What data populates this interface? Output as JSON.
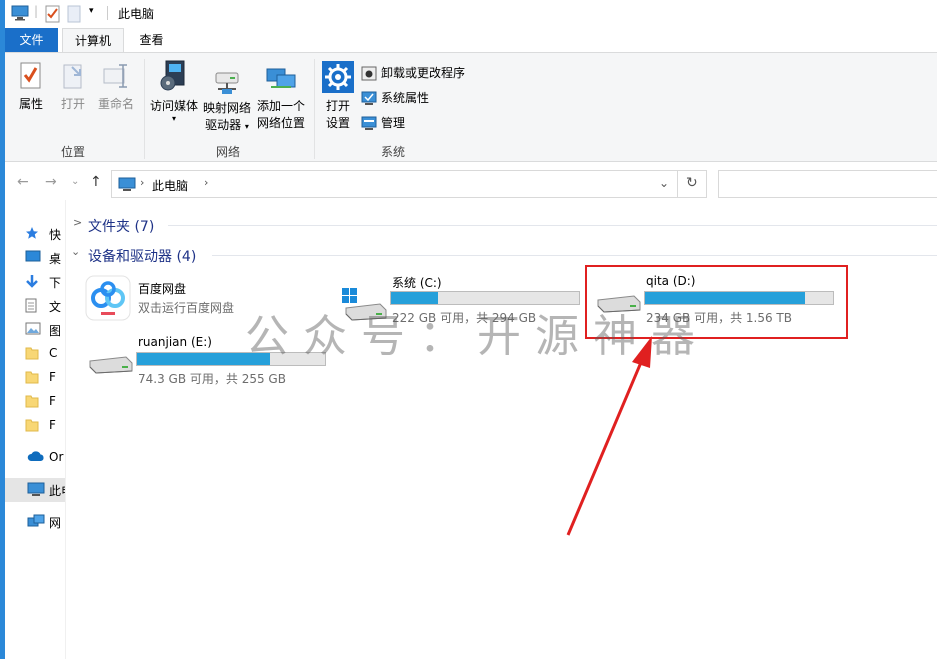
{
  "window": {
    "title": "此电脑"
  },
  "tabs": {
    "file": "文件",
    "computer": "计算机",
    "view": "查看"
  },
  "ribbon": {
    "location": {
      "label": "位置",
      "properties": "属性",
      "open": "打开",
      "rename": "重命名"
    },
    "network": {
      "label": "网络",
      "access_media": "访问媒体",
      "map_drive_line1": "映射网络",
      "map_drive_line2": "驱动器",
      "add_location_line1": "添加一个",
      "add_location_line2": "网络位置"
    },
    "system": {
      "label": "系统",
      "open_settings_line1": "打开",
      "open_settings_line2": "设置",
      "uninstall": "卸载或更改程序",
      "sys_props": "系统属性",
      "manage": "管理"
    }
  },
  "address": {
    "path": "此电脑"
  },
  "nav": {
    "items": [
      "快",
      "桌",
      "下",
      "文",
      "图",
      "C",
      "F",
      "F",
      "F",
      "Or",
      "此电",
      "网"
    ]
  },
  "sections": {
    "folders": "文件夹 (7)",
    "devices": "设备和驱动器 (4)"
  },
  "drives": [
    {
      "name": "百度网盘",
      "info": "双击运行百度网盘"
    },
    {
      "name": "系统 (C:)",
      "info": "222 GB 可用，共 294 GB",
      "usage": 0.25
    },
    {
      "name": "qita (D:)",
      "info": "234 GB 可用，共 1.56 TB",
      "usage": 0.85
    },
    {
      "name": "ruanjian (E:)",
      "info": "74.3 GB 可用，共 255 GB",
      "usage": 0.71
    }
  ],
  "watermark": "公众号：开源神器",
  "colors": {
    "accent": "#1a6fc9",
    "usage_bar": "#26a0da",
    "highlight": "#e02020",
    "section_text": "#1e3287"
  }
}
